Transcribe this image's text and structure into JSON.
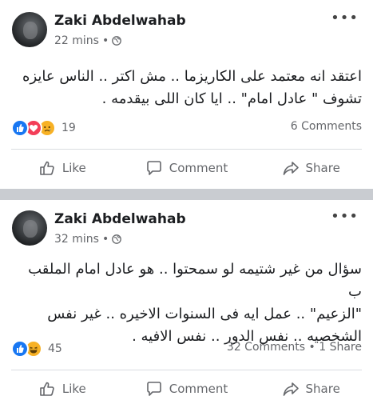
{
  "posts": [
    {
      "author": "Zaki Abdelwahab",
      "time": "22 mins",
      "dot": "•",
      "text_lines": [
        "اعتقد انه معتمد على الكاريزما .. مش اكتر .. الناس عايزه",
        "تشوف \" عادل امام\" .. ايا كان اللى بيقدمه ."
      ],
      "reactions": [
        "like",
        "love",
        "sad"
      ],
      "reaction_count": "19",
      "stats": "6 Comments"
    },
    {
      "author": "Zaki Abdelwahab",
      "time": "32 mins",
      "dot": "•",
      "text_lines": [
        "سؤال من غير شتيمه لو سمحتوا .. هو عادل امام الملقب ب",
        "\"الزعيم\" .. عمل ايه فى السنوات الاخيره .. غير نفس",
        "الشخصيه .. نفس الدور .. نفس الافيه ."
      ],
      "reactions": [
        "like",
        "haha"
      ],
      "reaction_count": "45",
      "stats": "32 Comments • 1 Share"
    }
  ],
  "actions": {
    "like": "Like",
    "comment": "Comment",
    "share": "Share"
  },
  "colors": {
    "like_blue": "#1877f2",
    "love_red": "#f33e58",
    "emoji_yellow": "#f7b125",
    "meta_gray": "#65676b"
  },
  "icons": [
    "globe-icon",
    "more-options-icon",
    "like-thumb-icon",
    "comment-bubble-icon",
    "share-arrow-icon"
  ]
}
